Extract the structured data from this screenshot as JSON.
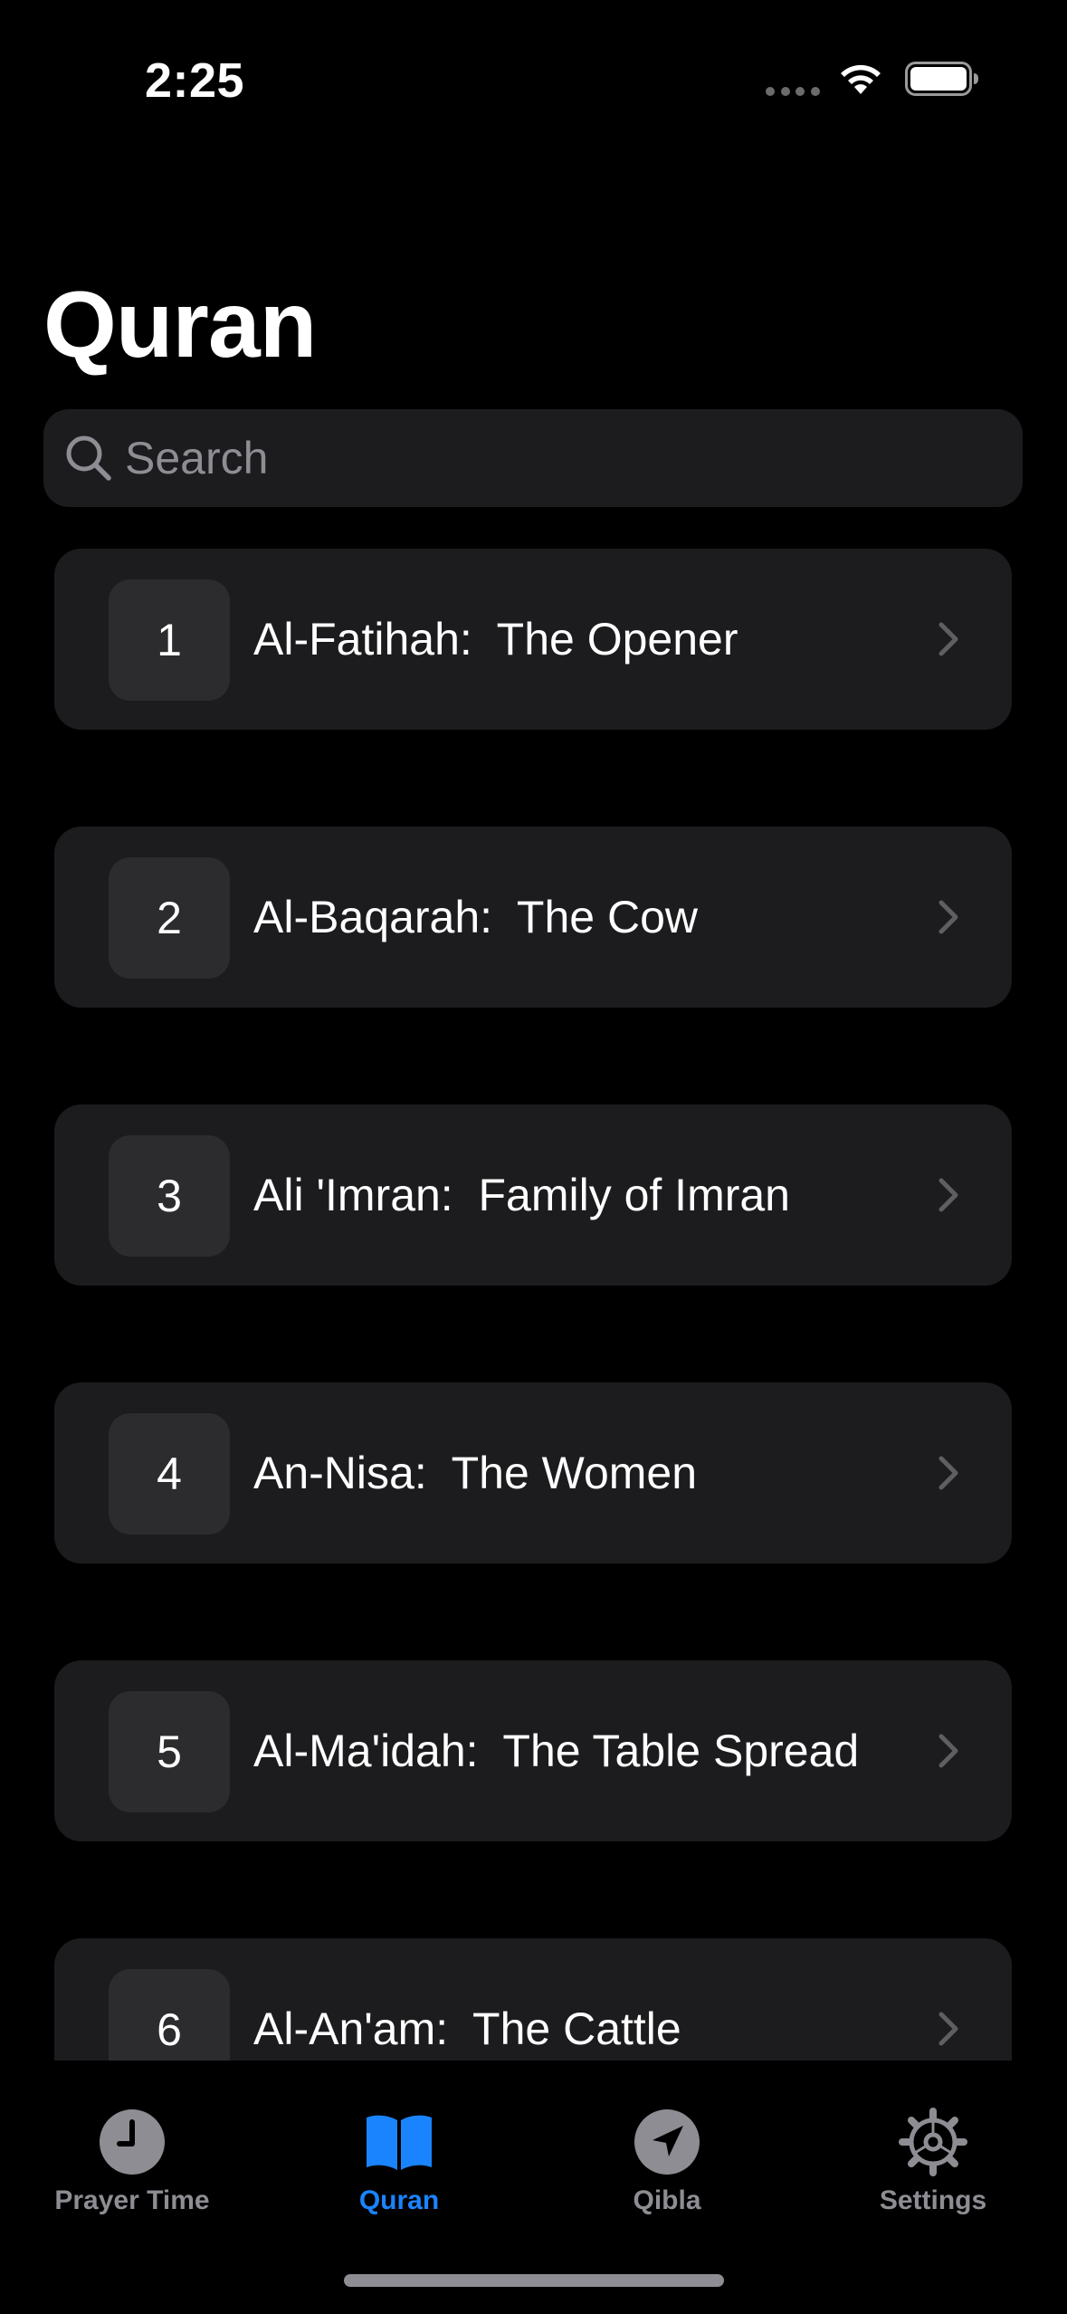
{
  "status_bar": {
    "time": "2:25"
  },
  "page": {
    "title": "Quran"
  },
  "search": {
    "placeholder": "Search",
    "value": ""
  },
  "surahs": [
    {
      "number": "1",
      "title": "Al-Fatihah:  The Opener"
    },
    {
      "number": "2",
      "title": "Al-Baqarah:  The Cow"
    },
    {
      "number": "3",
      "title": "Ali 'Imran:  Family of Imran"
    },
    {
      "number": "4",
      "title": "An-Nisa:  The Women"
    },
    {
      "number": "5",
      "title": "Al-Ma'idah:  The Table Spread"
    },
    {
      "number": "6",
      "title": "Al-An'am:  The Cattle"
    }
  ],
  "tab_bar": {
    "tabs": [
      {
        "label": "Prayer Time",
        "icon": "clock-icon",
        "active": false
      },
      {
        "label": "Quran",
        "icon": "book-icon",
        "active": true
      },
      {
        "label": "Qibla",
        "icon": "location-arrow-icon",
        "active": false
      },
      {
        "label": "Settings",
        "icon": "gear-icon",
        "active": false
      }
    ]
  },
  "colors": {
    "background": "#000000",
    "card": "#1c1c1e",
    "number_box": "#2c2c2e",
    "accent": "#1a84ff",
    "inactive": "#8d8d93"
  }
}
